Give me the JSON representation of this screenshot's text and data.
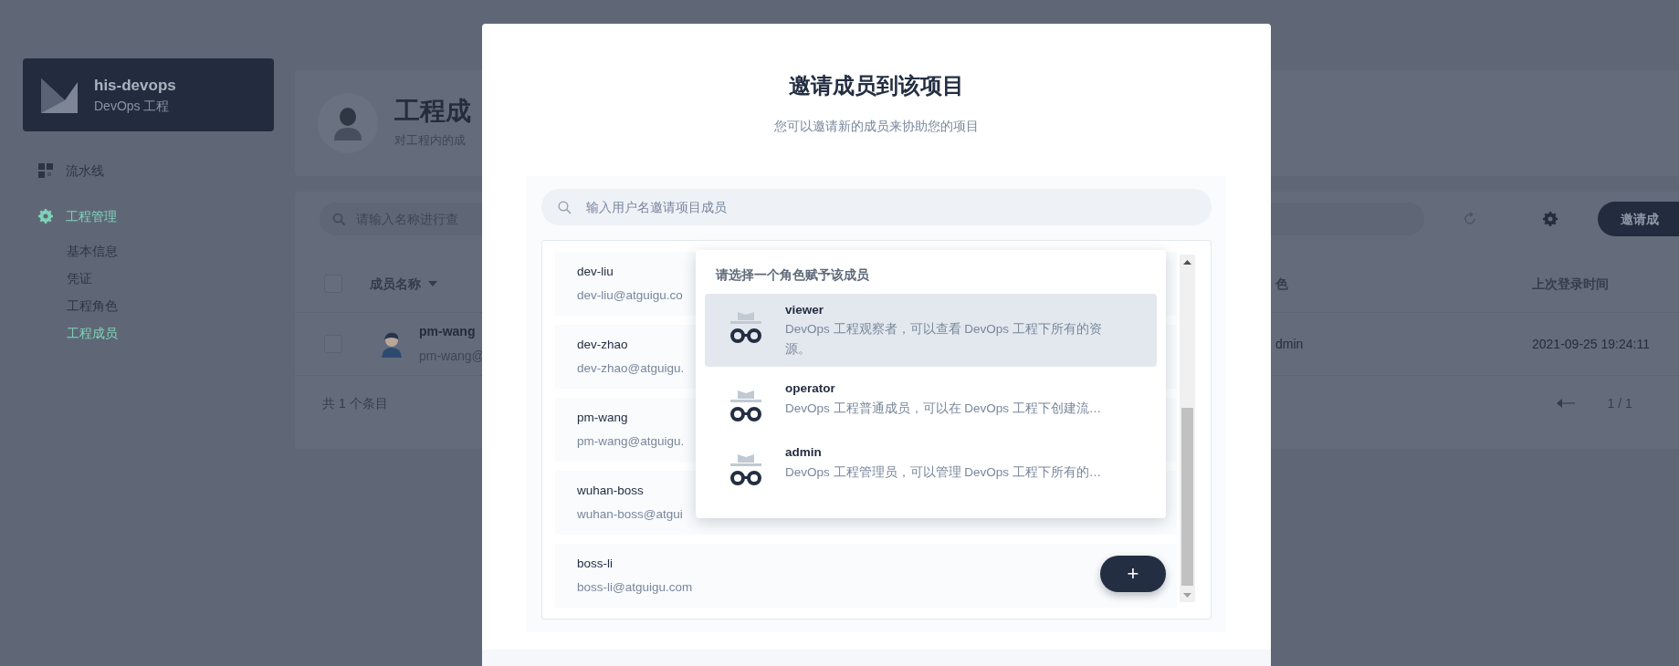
{
  "sidebar": {
    "project": {
      "name": "his-devops",
      "type": "DevOps 工程"
    },
    "items": [
      {
        "kind": "item",
        "label": "流水线",
        "selected": false
      },
      {
        "kind": "group",
        "label": "工程管理",
        "selected": true,
        "children": [
          {
            "label": "基本信息",
            "selected": false
          },
          {
            "label": "凭证",
            "selected": false
          },
          {
            "label": "工程角色",
            "selected": false
          },
          {
            "label": "工程成员",
            "selected": true
          }
        ]
      }
    ]
  },
  "page_header": {
    "title": "工程成",
    "description": "对工程内的成"
  },
  "toolbar": {
    "search_placeholder": "请输入名称进行查",
    "button": "邀请成"
  },
  "table": {
    "all_selected": false,
    "columns": [
      {
        "label": "成员名称",
        "sortable": true
      },
      {
        "label": "色",
        "sortable": false
      },
      {
        "label": "上次登录时间",
        "sortable": false
      }
    ],
    "rows": [
      {
        "selected": false,
        "name": "pm-wang",
        "email": "pm-wang@",
        "role": "dmin",
        "last_login": "2021-09-25 19:24:11"
      }
    ],
    "total": "共 1 个条目",
    "page": "1 / 1"
  },
  "modal": {
    "title": "邀请成员到该项目",
    "subtitle": "您可以邀请新的成员来协助您的项目",
    "search": {
      "placeholder": "输入用户名邀请项目成员"
    },
    "users": [
      {
        "name": "dev-liu",
        "email": "dev-liu@atguigu.co"
      },
      {
        "name": "dev-zhao",
        "email": "dev-zhao@atguigu."
      },
      {
        "name": "pm-wang",
        "email": "pm-wang@atguigu."
      },
      {
        "name": "wuhan-boss",
        "email": "wuhan-boss@atgui"
      },
      {
        "name": "boss-li",
        "email": "boss-li@atguigu.com"
      }
    ],
    "add_button": "+",
    "role_menu": {
      "heading": "请选择一个角色赋予该成员",
      "roles": [
        {
          "name": "viewer",
          "description": "DevOps 工程观察者，可以查看 DevOps 工程下所有的资源。",
          "selected": true
        },
        {
          "name": "operator",
          "description": "DevOps 工程普通成员，可以在 DevOps 工程下创建流…",
          "selected": false
        },
        {
          "name": "admin",
          "description": "DevOps 工程管理员，可以管理 DevOps 工程下所有的…",
          "selected": false
        }
      ]
    }
  }
}
